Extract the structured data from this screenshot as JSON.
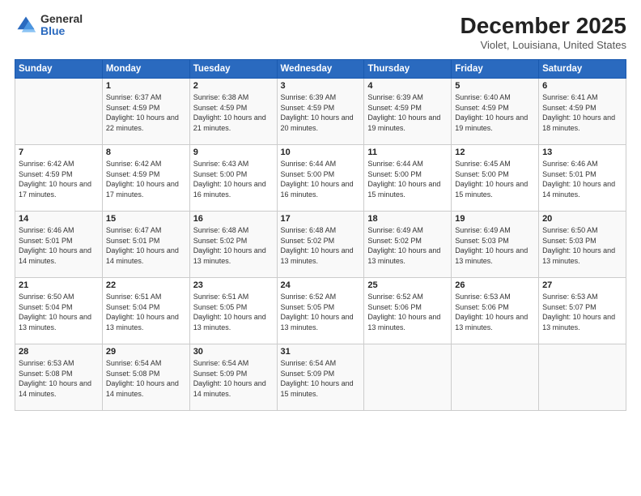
{
  "logo": {
    "general": "General",
    "blue": "Blue"
  },
  "header": {
    "title": "December 2025",
    "subtitle": "Violet, Louisiana, United States"
  },
  "columns": [
    "Sunday",
    "Monday",
    "Tuesday",
    "Wednesday",
    "Thursday",
    "Friday",
    "Saturday"
  ],
  "weeks": [
    [
      {
        "day": "",
        "sunrise": "",
        "sunset": "",
        "daylight": ""
      },
      {
        "day": "1",
        "sunrise": "Sunrise: 6:37 AM",
        "sunset": "Sunset: 4:59 PM",
        "daylight": "Daylight: 10 hours and 22 minutes."
      },
      {
        "day": "2",
        "sunrise": "Sunrise: 6:38 AM",
        "sunset": "Sunset: 4:59 PM",
        "daylight": "Daylight: 10 hours and 21 minutes."
      },
      {
        "day": "3",
        "sunrise": "Sunrise: 6:39 AM",
        "sunset": "Sunset: 4:59 PM",
        "daylight": "Daylight: 10 hours and 20 minutes."
      },
      {
        "day": "4",
        "sunrise": "Sunrise: 6:39 AM",
        "sunset": "Sunset: 4:59 PM",
        "daylight": "Daylight: 10 hours and 19 minutes."
      },
      {
        "day": "5",
        "sunrise": "Sunrise: 6:40 AM",
        "sunset": "Sunset: 4:59 PM",
        "daylight": "Daylight: 10 hours and 19 minutes."
      },
      {
        "day": "6",
        "sunrise": "Sunrise: 6:41 AM",
        "sunset": "Sunset: 4:59 PM",
        "daylight": "Daylight: 10 hours and 18 minutes."
      }
    ],
    [
      {
        "day": "7",
        "sunrise": "Sunrise: 6:42 AM",
        "sunset": "Sunset: 4:59 PM",
        "daylight": "Daylight: 10 hours and 17 minutes."
      },
      {
        "day": "8",
        "sunrise": "Sunrise: 6:42 AM",
        "sunset": "Sunset: 4:59 PM",
        "daylight": "Daylight: 10 hours and 17 minutes."
      },
      {
        "day": "9",
        "sunrise": "Sunrise: 6:43 AM",
        "sunset": "Sunset: 5:00 PM",
        "daylight": "Daylight: 10 hours and 16 minutes."
      },
      {
        "day": "10",
        "sunrise": "Sunrise: 6:44 AM",
        "sunset": "Sunset: 5:00 PM",
        "daylight": "Daylight: 10 hours and 16 minutes."
      },
      {
        "day": "11",
        "sunrise": "Sunrise: 6:44 AM",
        "sunset": "Sunset: 5:00 PM",
        "daylight": "Daylight: 10 hours and 15 minutes."
      },
      {
        "day": "12",
        "sunrise": "Sunrise: 6:45 AM",
        "sunset": "Sunset: 5:00 PM",
        "daylight": "Daylight: 10 hours and 15 minutes."
      },
      {
        "day": "13",
        "sunrise": "Sunrise: 6:46 AM",
        "sunset": "Sunset: 5:01 PM",
        "daylight": "Daylight: 10 hours and 14 minutes."
      }
    ],
    [
      {
        "day": "14",
        "sunrise": "Sunrise: 6:46 AM",
        "sunset": "Sunset: 5:01 PM",
        "daylight": "Daylight: 10 hours and 14 minutes."
      },
      {
        "day": "15",
        "sunrise": "Sunrise: 6:47 AM",
        "sunset": "Sunset: 5:01 PM",
        "daylight": "Daylight: 10 hours and 14 minutes."
      },
      {
        "day": "16",
        "sunrise": "Sunrise: 6:48 AM",
        "sunset": "Sunset: 5:02 PM",
        "daylight": "Daylight: 10 hours and 13 minutes."
      },
      {
        "day": "17",
        "sunrise": "Sunrise: 6:48 AM",
        "sunset": "Sunset: 5:02 PM",
        "daylight": "Daylight: 10 hours and 13 minutes."
      },
      {
        "day": "18",
        "sunrise": "Sunrise: 6:49 AM",
        "sunset": "Sunset: 5:02 PM",
        "daylight": "Daylight: 10 hours and 13 minutes."
      },
      {
        "day": "19",
        "sunrise": "Sunrise: 6:49 AM",
        "sunset": "Sunset: 5:03 PM",
        "daylight": "Daylight: 10 hours and 13 minutes."
      },
      {
        "day": "20",
        "sunrise": "Sunrise: 6:50 AM",
        "sunset": "Sunset: 5:03 PM",
        "daylight": "Daylight: 10 hours and 13 minutes."
      }
    ],
    [
      {
        "day": "21",
        "sunrise": "Sunrise: 6:50 AM",
        "sunset": "Sunset: 5:04 PM",
        "daylight": "Daylight: 10 hours and 13 minutes."
      },
      {
        "day": "22",
        "sunrise": "Sunrise: 6:51 AM",
        "sunset": "Sunset: 5:04 PM",
        "daylight": "Daylight: 10 hours and 13 minutes."
      },
      {
        "day": "23",
        "sunrise": "Sunrise: 6:51 AM",
        "sunset": "Sunset: 5:05 PM",
        "daylight": "Daylight: 10 hours and 13 minutes."
      },
      {
        "day": "24",
        "sunrise": "Sunrise: 6:52 AM",
        "sunset": "Sunset: 5:05 PM",
        "daylight": "Daylight: 10 hours and 13 minutes."
      },
      {
        "day": "25",
        "sunrise": "Sunrise: 6:52 AM",
        "sunset": "Sunset: 5:06 PM",
        "daylight": "Daylight: 10 hours and 13 minutes."
      },
      {
        "day": "26",
        "sunrise": "Sunrise: 6:53 AM",
        "sunset": "Sunset: 5:06 PM",
        "daylight": "Daylight: 10 hours and 13 minutes."
      },
      {
        "day": "27",
        "sunrise": "Sunrise: 6:53 AM",
        "sunset": "Sunset: 5:07 PM",
        "daylight": "Daylight: 10 hours and 13 minutes."
      }
    ],
    [
      {
        "day": "28",
        "sunrise": "Sunrise: 6:53 AM",
        "sunset": "Sunset: 5:08 PM",
        "daylight": "Daylight: 10 hours and 14 minutes."
      },
      {
        "day": "29",
        "sunrise": "Sunrise: 6:54 AM",
        "sunset": "Sunset: 5:08 PM",
        "daylight": "Daylight: 10 hours and 14 minutes."
      },
      {
        "day": "30",
        "sunrise": "Sunrise: 6:54 AM",
        "sunset": "Sunset: 5:09 PM",
        "daylight": "Daylight: 10 hours and 14 minutes."
      },
      {
        "day": "31",
        "sunrise": "Sunrise: 6:54 AM",
        "sunset": "Sunset: 5:09 PM",
        "daylight": "Daylight: 10 hours and 15 minutes."
      },
      {
        "day": "",
        "sunrise": "",
        "sunset": "",
        "daylight": ""
      },
      {
        "day": "",
        "sunrise": "",
        "sunset": "",
        "daylight": ""
      },
      {
        "day": "",
        "sunrise": "",
        "sunset": "",
        "daylight": ""
      }
    ]
  ]
}
